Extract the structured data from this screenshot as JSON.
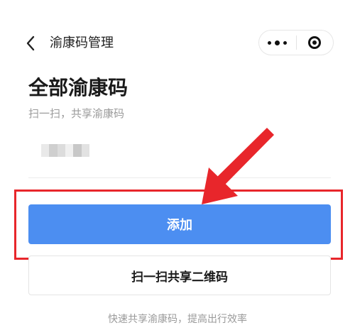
{
  "nav": {
    "back_icon": "chevron-left-icon",
    "title": "渝康码管理",
    "more_icon": "more-dots-icon",
    "close_icon": "target-circle-icon"
  },
  "header": {
    "title": "全部渝康码",
    "subtitle": "扫一扫，共享渝康码"
  },
  "entry": {
    "blurred": true,
    "blur_colors": [
      "#e9e9e9",
      "#cfcfcf",
      "#dcdcdc",
      "#f0f0f0",
      "#c8c8c8",
      "#e2e2e2"
    ]
  },
  "actions": {
    "add_label": "添加",
    "scan_label": "扫一扫共享二维码"
  },
  "footer": {
    "hint": "快速共享渝康码，提高出行效率"
  },
  "colors": {
    "primary_button": "#4c8ef1",
    "annotation_red": "#e8262b",
    "title_text": "#1a1a1a",
    "muted_text": "#9a9a9a"
  }
}
